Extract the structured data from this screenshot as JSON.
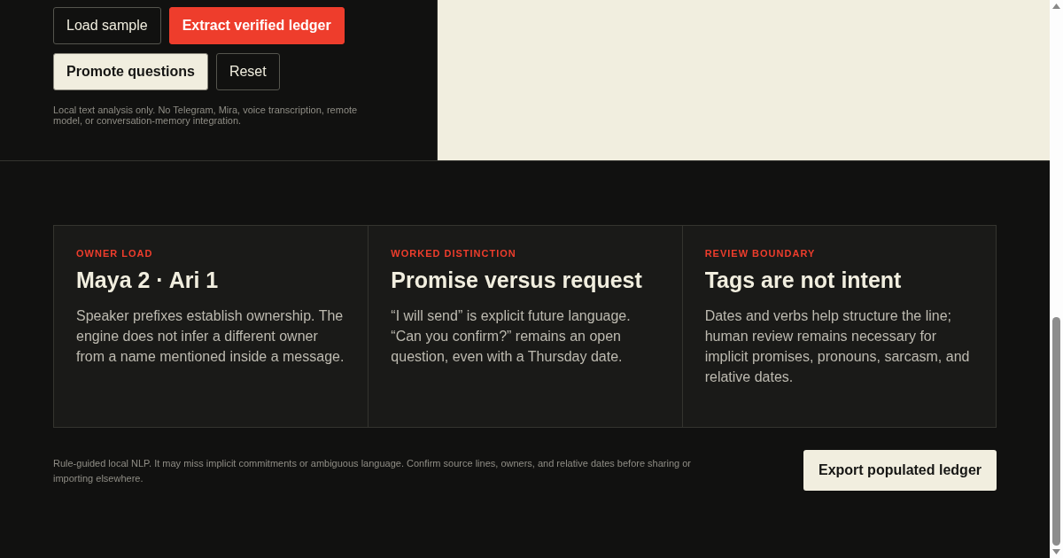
{
  "actions": [
    {
      "label": "Load sample",
      "kind": "outline"
    },
    {
      "label": "Extract verified ledger",
      "kind": "primary"
    },
    {
      "label": "Promote questions",
      "kind": "light"
    },
    {
      "label": "Reset",
      "kind": "outline"
    }
  ],
  "scope_note": "Local text analysis only. No Telegram, Mira, voice transcription, remote model, or conversation-memory integration.",
  "cards": [
    {
      "eyebrow": "OWNER LOAD",
      "title": "Maya 2 · Ari 1",
      "body": "Speaker prefixes establish ownership. The engine does not infer a different owner from a name mentioned inside a message."
    },
    {
      "eyebrow": "WORKED DISTINCTION",
      "title": "Promise versus request",
      "body": "“I will send” is explicit future language. “Can you confirm?” remains an open question, even with a Thursday date."
    },
    {
      "eyebrow": "REVIEW BOUNDARY",
      "title": "Tags are not intent",
      "body": "Dates and verbs help structure the line; human review remains necessary for implicit promises, pronouns, sarcasm, and relative dates."
    }
  ],
  "footer": {
    "disclaimer": "Rule-guided local NLP. It may miss implicit commitments or ambiguous language. Confirm source lines, owners, and relative dates before sharing or importing elsewhere.",
    "export_button": "Export populated ledger"
  }
}
